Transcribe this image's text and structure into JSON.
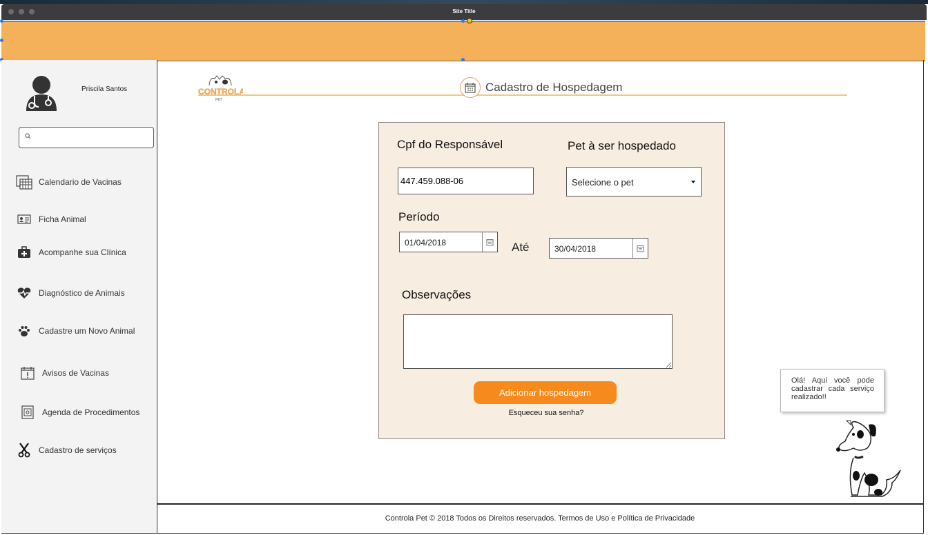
{
  "window": {
    "title": "Site Title"
  },
  "user": {
    "name": "Priscila Santos"
  },
  "search": {
    "placeholder": ""
  },
  "sidebar": {
    "items": [
      {
        "label": "Calendario de Vacinas",
        "icon": "calendar-grid-icon"
      },
      {
        "label": "Ficha Animal",
        "icon": "id-card-icon"
      },
      {
        "label": "Acompanhe sua Clínica",
        "icon": "medical-kit-icon"
      },
      {
        "label": "Diagnóstico de Animais",
        "icon": "heartbeat-icon"
      },
      {
        "label": "Cadastre um Novo Animal",
        "icon": "paw-icon"
      },
      {
        "label": "Avisos de Vacinas",
        "icon": "calendar-alert-icon"
      },
      {
        "label": "Agenda de Procedimentos",
        "icon": "safe-icon"
      },
      {
        "label": "Cadastro de serviços",
        "icon": "scissors-icon"
      }
    ]
  },
  "header": {
    "logo_text": "CONTROLA",
    "logo_subtext": "PET",
    "title": "Cadastro de Hospedagem"
  },
  "form": {
    "cpf_label": "Cpf do Responsável",
    "cpf_value": "447.459.088-06",
    "pet_label": "Pet à ser hospedado",
    "pet_selected": "Selecione o pet",
    "periodo_label": "Período",
    "start_date": "01/04/2018",
    "until_label": "Até",
    "end_date": "30/04/2018",
    "obs_label": "Observações",
    "obs_value": "",
    "submit_label": "Adicionar hospedagem",
    "forgot_label": "Esqueceu sua senha?"
  },
  "mascot": {
    "message": "Olá! Aqui você pode cadastrar cada serviço realizado!!"
  },
  "footer": {
    "text": "Controla Pet © 2018 Todos os Direitos reservados. Termos de Uso e Política de Privacidade"
  },
  "colors": {
    "banner": "#f5b05a",
    "accent": "#f78a1d",
    "card": "#f8ede1",
    "sidebar": "#f3f3f3"
  }
}
